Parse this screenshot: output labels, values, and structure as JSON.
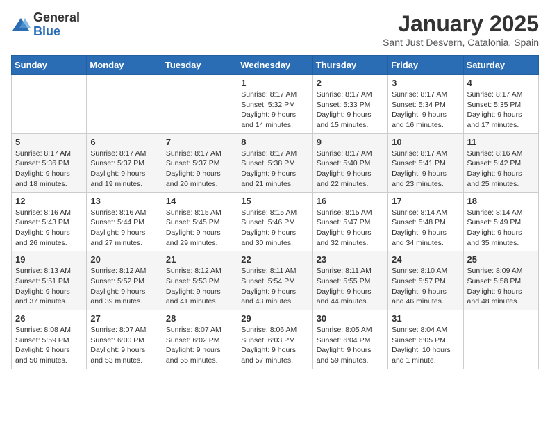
{
  "header": {
    "logo": {
      "general": "General",
      "blue": "Blue"
    },
    "title": "January 2025",
    "location": "Sant Just Desvern, Catalonia, Spain"
  },
  "weekdays": [
    "Sunday",
    "Monday",
    "Tuesday",
    "Wednesday",
    "Thursday",
    "Friday",
    "Saturday"
  ],
  "weeks": [
    [
      {
        "day": "",
        "info": ""
      },
      {
        "day": "",
        "info": ""
      },
      {
        "day": "",
        "info": ""
      },
      {
        "day": "1",
        "info": "Sunrise: 8:17 AM\nSunset: 5:32 PM\nDaylight: 9 hours\nand 14 minutes."
      },
      {
        "day": "2",
        "info": "Sunrise: 8:17 AM\nSunset: 5:33 PM\nDaylight: 9 hours\nand 15 minutes."
      },
      {
        "day": "3",
        "info": "Sunrise: 8:17 AM\nSunset: 5:34 PM\nDaylight: 9 hours\nand 16 minutes."
      },
      {
        "day": "4",
        "info": "Sunrise: 8:17 AM\nSunset: 5:35 PM\nDaylight: 9 hours\nand 17 minutes."
      }
    ],
    [
      {
        "day": "5",
        "info": "Sunrise: 8:17 AM\nSunset: 5:36 PM\nDaylight: 9 hours\nand 18 minutes."
      },
      {
        "day": "6",
        "info": "Sunrise: 8:17 AM\nSunset: 5:37 PM\nDaylight: 9 hours\nand 19 minutes."
      },
      {
        "day": "7",
        "info": "Sunrise: 8:17 AM\nSunset: 5:37 PM\nDaylight: 9 hours\nand 20 minutes."
      },
      {
        "day": "8",
        "info": "Sunrise: 8:17 AM\nSunset: 5:38 PM\nDaylight: 9 hours\nand 21 minutes."
      },
      {
        "day": "9",
        "info": "Sunrise: 8:17 AM\nSunset: 5:40 PM\nDaylight: 9 hours\nand 22 minutes."
      },
      {
        "day": "10",
        "info": "Sunrise: 8:17 AM\nSunset: 5:41 PM\nDaylight: 9 hours\nand 23 minutes."
      },
      {
        "day": "11",
        "info": "Sunrise: 8:16 AM\nSunset: 5:42 PM\nDaylight: 9 hours\nand 25 minutes."
      }
    ],
    [
      {
        "day": "12",
        "info": "Sunrise: 8:16 AM\nSunset: 5:43 PM\nDaylight: 9 hours\nand 26 minutes."
      },
      {
        "day": "13",
        "info": "Sunrise: 8:16 AM\nSunset: 5:44 PM\nDaylight: 9 hours\nand 27 minutes."
      },
      {
        "day": "14",
        "info": "Sunrise: 8:15 AM\nSunset: 5:45 PM\nDaylight: 9 hours\nand 29 minutes."
      },
      {
        "day": "15",
        "info": "Sunrise: 8:15 AM\nSunset: 5:46 PM\nDaylight: 9 hours\nand 30 minutes."
      },
      {
        "day": "16",
        "info": "Sunrise: 8:15 AM\nSunset: 5:47 PM\nDaylight: 9 hours\nand 32 minutes."
      },
      {
        "day": "17",
        "info": "Sunrise: 8:14 AM\nSunset: 5:48 PM\nDaylight: 9 hours\nand 34 minutes."
      },
      {
        "day": "18",
        "info": "Sunrise: 8:14 AM\nSunset: 5:49 PM\nDaylight: 9 hours\nand 35 minutes."
      }
    ],
    [
      {
        "day": "19",
        "info": "Sunrise: 8:13 AM\nSunset: 5:51 PM\nDaylight: 9 hours\nand 37 minutes."
      },
      {
        "day": "20",
        "info": "Sunrise: 8:12 AM\nSunset: 5:52 PM\nDaylight: 9 hours\nand 39 minutes."
      },
      {
        "day": "21",
        "info": "Sunrise: 8:12 AM\nSunset: 5:53 PM\nDaylight: 9 hours\nand 41 minutes."
      },
      {
        "day": "22",
        "info": "Sunrise: 8:11 AM\nSunset: 5:54 PM\nDaylight: 9 hours\nand 43 minutes."
      },
      {
        "day": "23",
        "info": "Sunrise: 8:11 AM\nSunset: 5:55 PM\nDaylight: 9 hours\nand 44 minutes."
      },
      {
        "day": "24",
        "info": "Sunrise: 8:10 AM\nSunset: 5:57 PM\nDaylight: 9 hours\nand 46 minutes."
      },
      {
        "day": "25",
        "info": "Sunrise: 8:09 AM\nSunset: 5:58 PM\nDaylight: 9 hours\nand 48 minutes."
      }
    ],
    [
      {
        "day": "26",
        "info": "Sunrise: 8:08 AM\nSunset: 5:59 PM\nDaylight: 9 hours\nand 50 minutes."
      },
      {
        "day": "27",
        "info": "Sunrise: 8:07 AM\nSunset: 6:00 PM\nDaylight: 9 hours\nand 53 minutes."
      },
      {
        "day": "28",
        "info": "Sunrise: 8:07 AM\nSunset: 6:02 PM\nDaylight: 9 hours\nand 55 minutes."
      },
      {
        "day": "29",
        "info": "Sunrise: 8:06 AM\nSunset: 6:03 PM\nDaylight: 9 hours\nand 57 minutes."
      },
      {
        "day": "30",
        "info": "Sunrise: 8:05 AM\nSunset: 6:04 PM\nDaylight: 9 hours\nand 59 minutes."
      },
      {
        "day": "31",
        "info": "Sunrise: 8:04 AM\nSunset: 6:05 PM\nDaylight: 10 hours\nand 1 minute."
      },
      {
        "day": "",
        "info": ""
      }
    ]
  ]
}
